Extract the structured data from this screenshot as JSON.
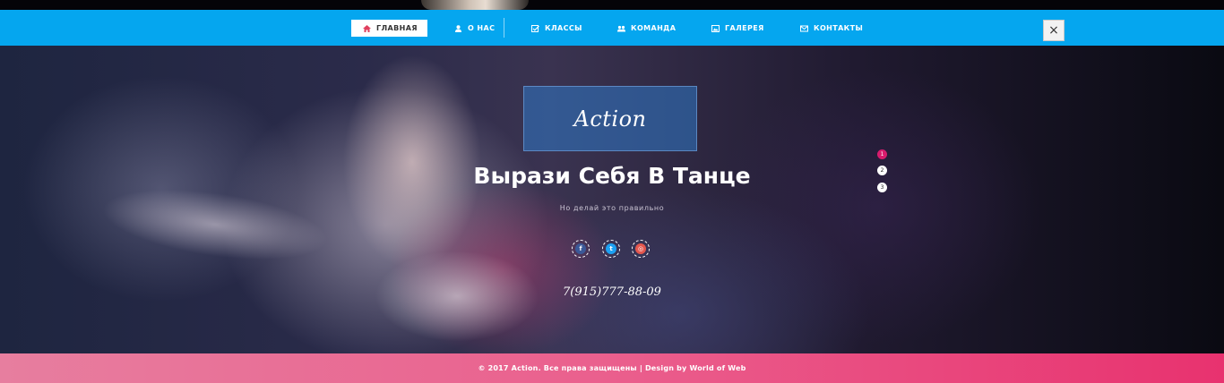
{
  "nav": {
    "items": [
      {
        "label": "ГЛАВНАЯ",
        "icon": "home-icon",
        "active": true
      },
      {
        "label": "О НАС",
        "icon": "user-icon",
        "active": false
      },
      {
        "label": "КЛАССЫ",
        "icon": "checkbox-icon",
        "active": false
      },
      {
        "label": "КОМАНДА",
        "icon": "group-icon",
        "active": false
      },
      {
        "label": "ГАЛЕРЕЯ",
        "icon": "image-icon",
        "active": false
      },
      {
        "label": "КОНТАКТЫ",
        "icon": "envelope-icon",
        "active": false
      }
    ],
    "close_label": "×"
  },
  "hero": {
    "logo": "Action",
    "headline": "Вырази Себя В Танце",
    "subline": "Но делай это правильно",
    "social": [
      {
        "icon": "facebook-icon",
        "glyph": "f",
        "color": "#3b5998"
      },
      {
        "icon": "twitter-icon",
        "glyph": "t",
        "color": "#1da1f2"
      },
      {
        "icon": "instagram-icon",
        "glyph": "◎",
        "color": "#e4574e"
      }
    ],
    "phone": "7(915)777-88-09",
    "slides": [
      "1",
      "2",
      "3"
    ],
    "active_slide": 1
  },
  "footer": {
    "text": "© 2017 Action. Все права защищены | Design by World of Web"
  },
  "colors": {
    "nav_bg": "#05a6ef",
    "accent_pink": "#d81c6d",
    "footer_start": "#e77e9f",
    "footer_end": "#e8326f"
  }
}
